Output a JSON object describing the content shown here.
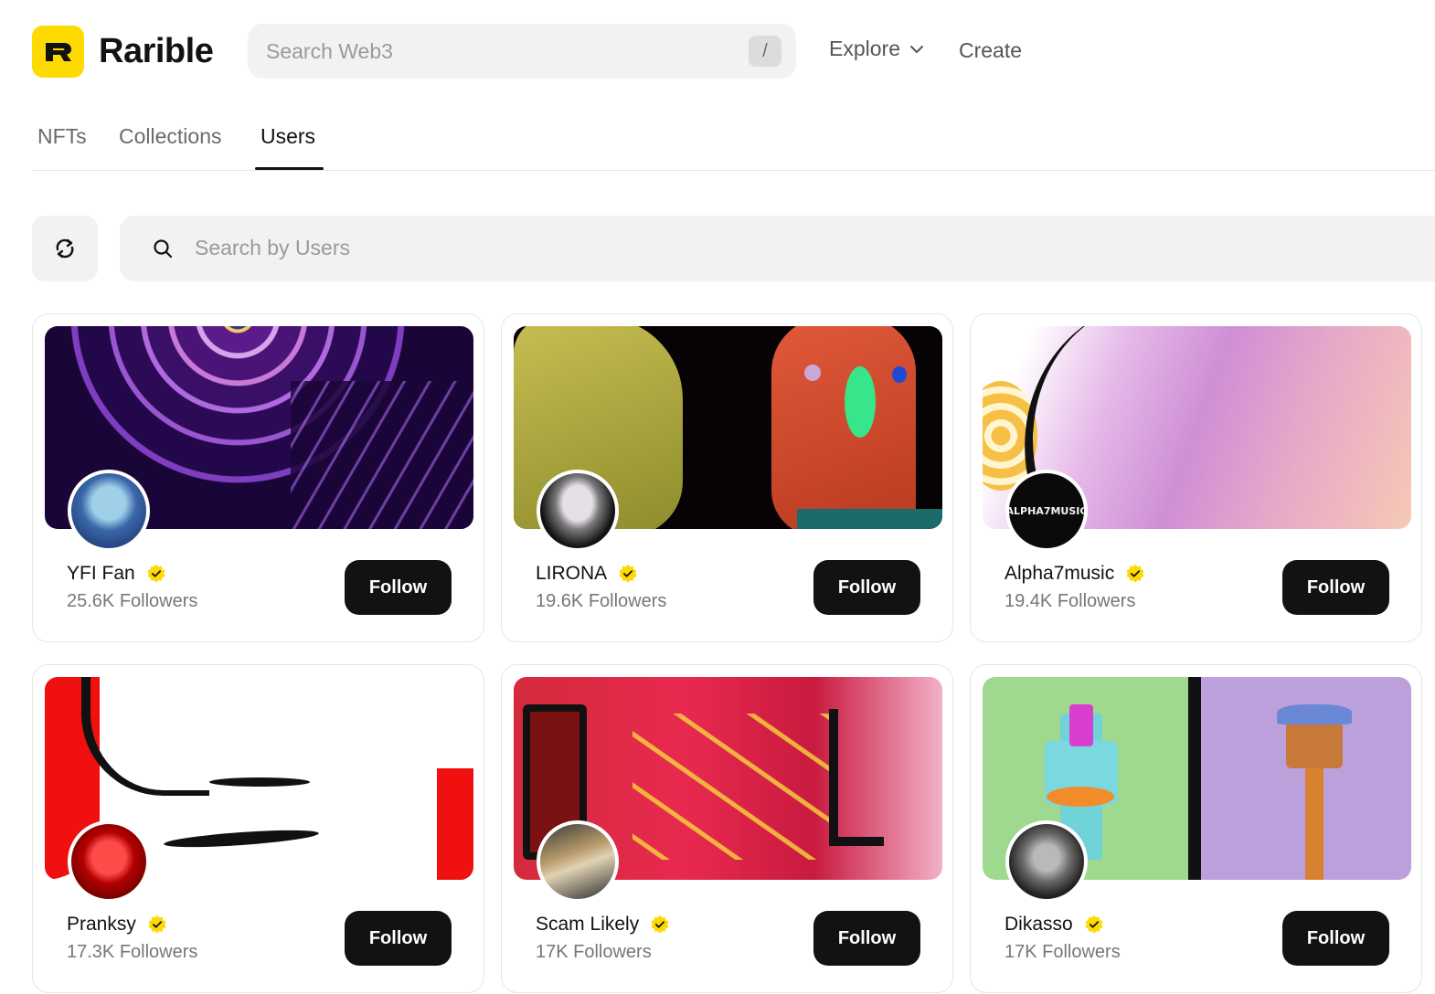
{
  "header": {
    "brand": "Rarible",
    "search_placeholder": "Search Web3",
    "search_shortcut": "/",
    "nav_explore": "Explore",
    "nav_create": "Create"
  },
  "tabs": [
    {
      "label": "NFTs",
      "active": false
    },
    {
      "label": "Collections",
      "active": false
    },
    {
      "label": "Users",
      "active": true
    }
  ],
  "filter": {
    "search_placeholder": "Search by Users"
  },
  "colors": {
    "brand_yellow": "#FEDA03",
    "button_dark": "#121212",
    "muted_text": "#777777"
  },
  "icons": {
    "logo": "rarible-logo-icon",
    "refresh": "refresh-icon",
    "search": "search-icon",
    "chevron": "chevron-down-icon",
    "verified": "verified-badge-icon"
  },
  "users": [
    {
      "name": "YFI Fan",
      "followers": "25.6K Followers",
      "verified": true,
      "button": "Follow"
    },
    {
      "name": "LIRONA",
      "followers": "19.6K Followers",
      "verified": true,
      "button": "Follow"
    },
    {
      "name": "Alpha7music",
      "followers": "19.4K Followers",
      "verified": true,
      "button": "Follow",
      "avatar_text": "ALPHA7MUSIC"
    },
    {
      "name": "Pranksy",
      "followers": "17.3K Followers",
      "verified": true,
      "button": "Follow"
    },
    {
      "name": "Scam Likely",
      "followers": "17K Followers",
      "verified": true,
      "button": "Follow"
    },
    {
      "name": "Dikasso",
      "followers": "17K Followers",
      "verified": true,
      "button": "Follow"
    }
  ]
}
